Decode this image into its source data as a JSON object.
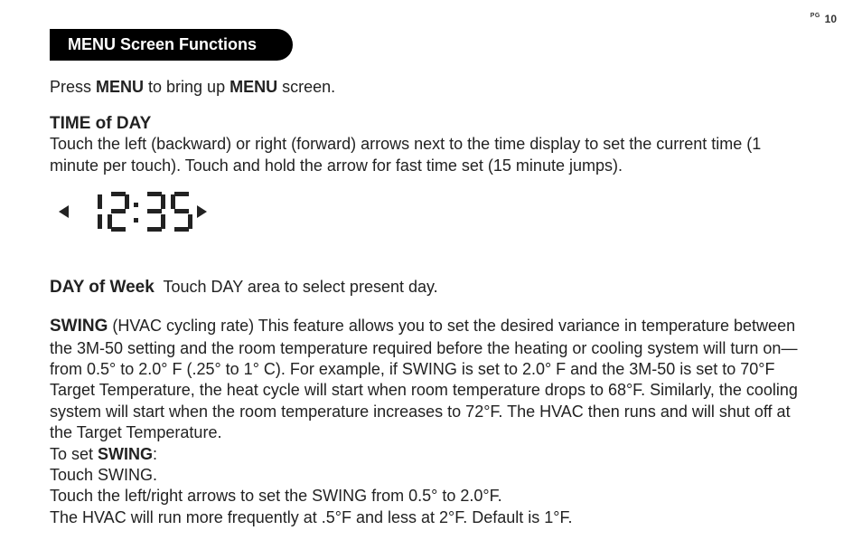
{
  "page_number_label": "PG",
  "page_number": "10",
  "header": "MENU Screen Functions",
  "intro_prefix": "Press ",
  "intro_bold1": "MENU",
  "intro_mid": " to bring up ",
  "intro_bold2": "MENU",
  "intro_suffix": " screen.",
  "time_heading": "TIME of DAY",
  "time_text": "Touch the left (backward) or right (forward) arrows next to the time display to set the current time (1 minute per touch). Touch and hold the arrow for fast time set (15 minute jumps).",
  "time_value": "12:35",
  "day_heading": "DAY of Week",
  "day_text": "  Touch DAY area to select present day.",
  "swing_heading": "SWING",
  "swing_text": "   (HVAC cycling rate)  This feature allows you to set the desired variance in temperature between the  3M-50 setting and the room temperature required before the heating or cooling system will turn on—from 0.5° to 2.0° F (.25° to 1° C). For example, if SWING is set to 2.0° F and the 3M-50 is set to 70°F Target Temperature, the heat cycle will start when room temperature drops to 68°F. Similarly, the cooling system will start when the room temperature increases to 72°F. The HVAC then runs and will shut off at the Target Temperature.",
  "swing_toset_prefix": "To set ",
  "swing_toset_bold": "SWING",
  "swing_toset_suffix": ":",
  "swing_line2": "Touch SWING.",
  "swing_line3": "Touch the left/right arrows to set the SWING from 0.5° to 2.0°F.",
  "swing_line4": "The HVAC will run more frequently at .5°F and less at 2°F.  Default is 1°F."
}
